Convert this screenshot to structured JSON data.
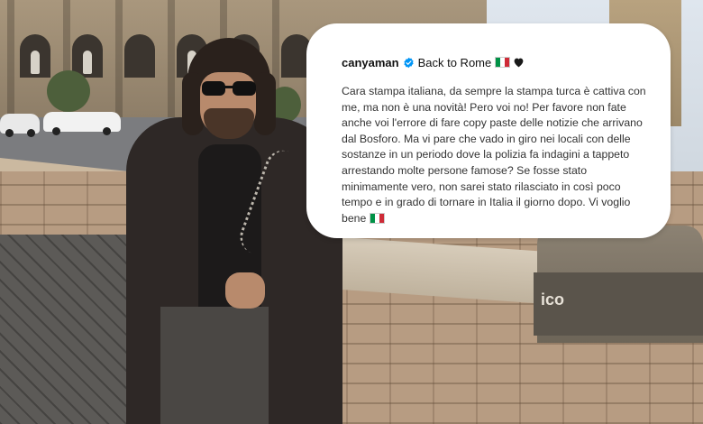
{
  "post": {
    "username": "canyaman",
    "caption": "Back to Rome",
    "body": "Cara stampa italiana, da sempre la stampa turca è cattiva con me, ma non è una novità! Pero voi no! Per favore non fate anche voi l'errore di fare copy paste delle notizie che arrivano dal Bosforo. Ma vi pare che vado in giro nei locali con delle sostanze in un periodo dove la polizia fa indagini a tappeto arrestando molte persone famose? Se fosse stato minimamente vero, non sarei stato rilasciato in così poco tempo e in grado di tornare in Italia il giorno dopo. Vi voglio bene",
    "icons": [
      "verified-badge-icon",
      "italy-flag-icon",
      "black-heart-icon"
    ]
  },
  "scene": {
    "pedestal_text": "ico"
  },
  "colors": {
    "verified": "#0095f6",
    "flag_green": "#009246",
    "flag_white": "#ffffff",
    "flag_red": "#ce2b37",
    "heart": "#1a1a1a",
    "card_background": "#ffffff"
  }
}
